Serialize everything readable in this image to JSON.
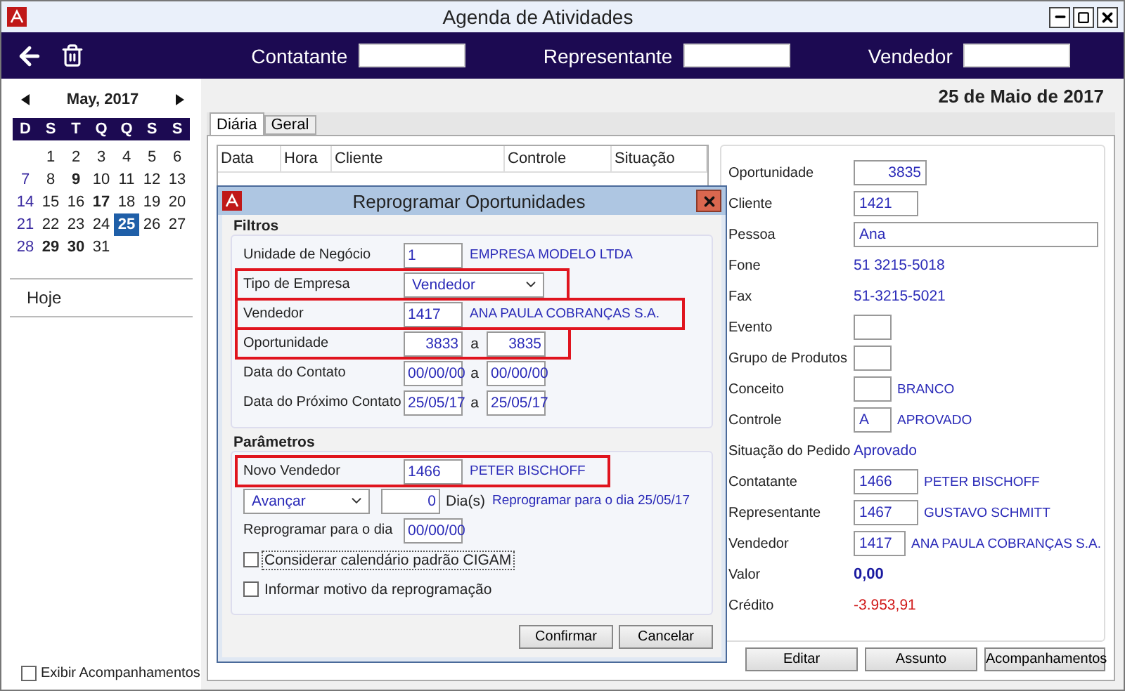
{
  "window": {
    "title": "Agenda de Atividades"
  },
  "toolbar": {
    "filters": [
      {
        "label": "Contatante"
      },
      {
        "label": "Representante"
      },
      {
        "label": "Vendedor"
      }
    ]
  },
  "calendar": {
    "month": "May, 2017",
    "weekdays": [
      "D",
      "S",
      "T",
      "Q",
      "Q",
      "S",
      "S"
    ],
    "weeks": [
      {
        "starts_midweek": true,
        "days": [
          {
            "day": "1",
            "marked": false,
            "selected": false
          },
          {
            "day": "2",
            "marked": false,
            "selected": false
          },
          {
            "day": "3",
            "marked": false,
            "selected": false
          },
          {
            "day": "4",
            "marked": false,
            "selected": false
          },
          {
            "day": "5",
            "marked": false,
            "selected": false
          },
          {
            "day": "6",
            "marked": false,
            "selected": false
          }
        ]
      },
      {
        "starts_midweek": false,
        "days": [
          {
            "day": "7",
            "marked": false,
            "selected": false
          },
          {
            "day": "8",
            "marked": false,
            "selected": false
          },
          {
            "day": "9",
            "marked": true,
            "selected": false
          },
          {
            "day": "10",
            "marked": false,
            "selected": false
          },
          {
            "day": "11",
            "marked": false,
            "selected": false
          },
          {
            "day": "12",
            "marked": false,
            "selected": false
          },
          {
            "day": "13",
            "marked": false,
            "selected": false
          }
        ]
      },
      {
        "starts_midweek": false,
        "days": [
          {
            "day": "14",
            "marked": false,
            "selected": false
          },
          {
            "day": "15",
            "marked": false,
            "selected": false
          },
          {
            "day": "16",
            "marked": false,
            "selected": false
          },
          {
            "day": "17",
            "marked": true,
            "selected": false
          },
          {
            "day": "18",
            "marked": false,
            "selected": false
          },
          {
            "day": "19",
            "marked": false,
            "selected": false
          },
          {
            "day": "20",
            "marked": false,
            "selected": false
          }
        ]
      },
      {
        "starts_midweek": false,
        "days": [
          {
            "day": "21",
            "marked": false,
            "selected": false
          },
          {
            "day": "22",
            "marked": false,
            "selected": false
          },
          {
            "day": "23",
            "marked": false,
            "selected": false
          },
          {
            "day": "24",
            "marked": false,
            "selected": false
          },
          {
            "day": "25",
            "marked": true,
            "selected": true
          },
          {
            "day": "26",
            "marked": false,
            "selected": false
          },
          {
            "day": "27",
            "marked": false,
            "selected": false
          }
        ]
      },
      {
        "starts_midweek": false,
        "days": [
          {
            "day": "28",
            "marked": false,
            "selected": false
          },
          {
            "day": "29",
            "marked": true,
            "selected": false
          },
          {
            "day": "30",
            "marked": true,
            "selected": false
          },
          {
            "day": "31",
            "marked": false,
            "selected": false
          }
        ]
      }
    ]
  },
  "today_link": "Hoje",
  "show_followups": {
    "label": "Exibir Acompanhamentos",
    "checked": false
  },
  "date_heading": "25 de Maio de 2017",
  "tabs": [
    {
      "label": "Diária",
      "selected": true
    },
    {
      "label": "Geral",
      "selected": false
    }
  ],
  "table": {
    "columns": [
      "Data",
      "Hora",
      "Cliente",
      "Controle",
      "Situação"
    ]
  },
  "details": {
    "fields": [
      {
        "kind": "number",
        "label": "Oportunidade",
        "value": "3835"
      },
      {
        "kind": "field",
        "label": "Cliente",
        "value": "1421"
      },
      {
        "kind": "wide",
        "label": "Pessoa",
        "value": "Ana"
      },
      {
        "kind": "text",
        "label": "Fone",
        "value": "51 3215-5018"
      },
      {
        "kind": "text",
        "label": "Fax",
        "value": "51-3215-5021"
      },
      {
        "kind": "blank",
        "label": "Evento"
      },
      {
        "kind": "blank",
        "label": "Grupo de Produtos"
      },
      {
        "kind": "blank",
        "label": "Conceito",
        "name": "BRANCO"
      },
      {
        "kind": "short",
        "label": "Controle",
        "value": "A",
        "name": "APROVADO"
      },
      {
        "kind": "text",
        "label": "Situação do Pedido",
        "value": "Aprovado"
      },
      {
        "kind": "field",
        "label": "Contatante",
        "value": "1466",
        "name": "PETER BISCHOFF"
      },
      {
        "kind": "field",
        "label": "Representante",
        "value": "1467",
        "name": "GUSTAVO SCHMITT"
      },
      {
        "kind": "field",
        "label": "Vendedor",
        "value": "1417",
        "name": "ANA PAULA COBRANÇAS S.A."
      },
      {
        "kind": "amount",
        "label": "Valor",
        "value": "0,00"
      },
      {
        "kind": "debit",
        "label": "Crédito",
        "value": "-3.953,91"
      }
    ],
    "buttons": [
      "Editar",
      "Assunto",
      "Acompanhamentos"
    ]
  },
  "dialog": {
    "title": "Reprogramar Oportunidades",
    "filters": {
      "title": "Filtros",
      "rows": [
        {
          "kind": "code",
          "label": "Unidade de Negócio",
          "value": "1",
          "name": "EMPRESA MODELO LTDA",
          "highlighted": false
        },
        {
          "kind": "select",
          "label": "Tipo de Empresa",
          "value": "Vendedor",
          "highlighted": true
        },
        {
          "kind": "code",
          "label": "Vendedor",
          "value": "1417",
          "name": "ANA PAULA COBRANÇAS S.A.",
          "highlighted": true
        },
        {
          "kind": "number_range",
          "label": "Oportunidade",
          "from": "3833",
          "separator": "a",
          "to": "3835",
          "highlighted": true
        },
        {
          "kind": "range",
          "label": "Data do Contato",
          "from": "00/00/00",
          "separator": "a",
          "to": "00/00/00",
          "highlighted": false
        },
        {
          "kind": "range",
          "label": "Data do Próximo Contato",
          "from": "25/05/17",
          "separator": "a",
          "to": "25/05/17",
          "highlighted": false
        }
      ]
    },
    "parameters": {
      "title": "Parâmetros",
      "rows": [
        {
          "kind": "code",
          "label": "Novo Vendedor",
          "value": "1466",
          "name": "PETER BISCHOFF",
          "highlighted": true
        },
        {
          "kind": "shift",
          "action": "Avançar",
          "value": "0",
          "unit": "Dia(s)",
          "note": "Reprogramar para o dia 25/05/17",
          "highlighted": false
        },
        {
          "kind": "date",
          "label": "Reprogramar para o dia",
          "value": "00/00/00",
          "highlighted": false
        },
        {
          "kind": "check",
          "label": "Considerar calendário padrão CIGAM",
          "checked": false,
          "focused": true,
          "highlighted": false
        },
        {
          "kind": "check",
          "label": "Informar motivo da reprogramação",
          "checked": false,
          "focused": false,
          "highlighted": false
        }
      ]
    },
    "buttons": [
      "Confirmar",
      "Cancelar"
    ]
  }
}
